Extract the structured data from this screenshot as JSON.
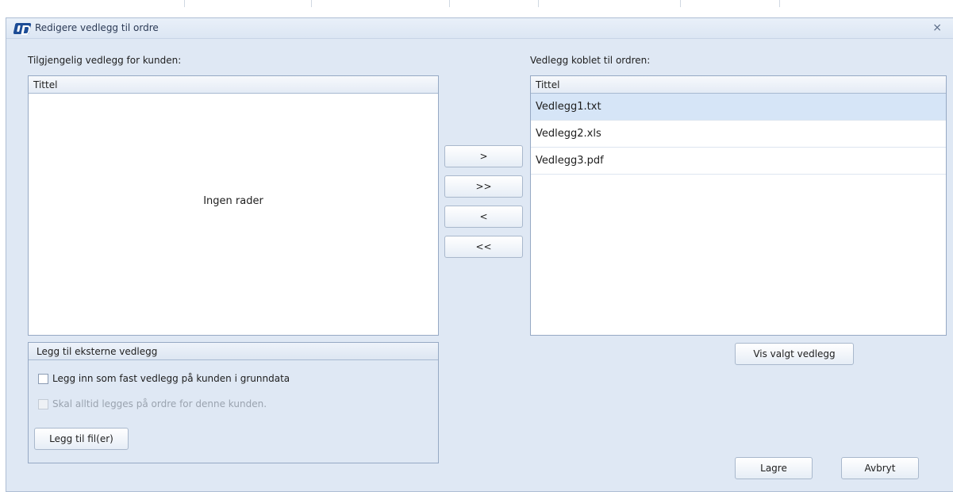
{
  "window": {
    "title": "Redigere vedlegg til ordre"
  },
  "available": {
    "label": "Tilgjengelig vedlegg for kunden:",
    "column_header": "Tittel",
    "empty_text": "Ingen rader"
  },
  "linked": {
    "label": "Vedlegg koblet til ordren:",
    "column_header": "Tittel",
    "rows": [
      "Vedlegg1.txt",
      "Vedlegg2.xls",
      "Vedlegg3.pdf"
    ],
    "selected_row": "Vedlegg1.txt"
  },
  "transfer": {
    "move_one": ">",
    "move_all": ">>",
    "remove_one": "<",
    "remove_all": "<<"
  },
  "external": {
    "header": "Legg til eksterne vedlegg",
    "option_fixed": "Legg inn som fast vedlegg på kunden i grunndata",
    "option_always": "Skal alltid legges på ordre for denne kunden.",
    "add_files_label": "Legg til fil(er)"
  },
  "actions": {
    "show_selected": "Vis valgt vedlegg",
    "save": "Lagre",
    "cancel": "Avbryt"
  },
  "colors": {
    "window_bg": "#dfe8f4",
    "selection": "#d6e5f7",
    "brand_icon": "#1c4c96"
  }
}
